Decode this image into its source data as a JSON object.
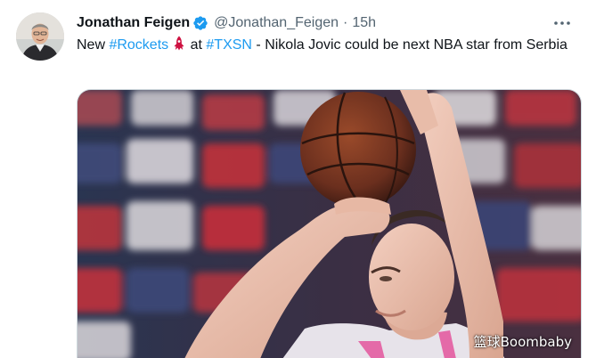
{
  "tweet": {
    "author_name": "Jonathan Feigen",
    "handle": "@Jonathan_Feigen",
    "separator": "·",
    "time": "15h",
    "text_before": "New ",
    "hashtag_rockets": "#Rockets",
    "text_at": " at ",
    "hashtag_txsn": "#TXSN",
    "text_after": " - Nikola Jovic could be next NBA star from Serbia"
  },
  "media": {
    "watermark": "篮球Boombaby"
  },
  "colors": {
    "link": "#1d9bf0",
    "verified": "#1d9bf0",
    "rockets": "#ce1141",
    "secondary_text": "#536471"
  },
  "icons": {
    "verified": "verified-badge-icon",
    "more": "more-options-icon",
    "team": "rockets-logo-icon"
  }
}
